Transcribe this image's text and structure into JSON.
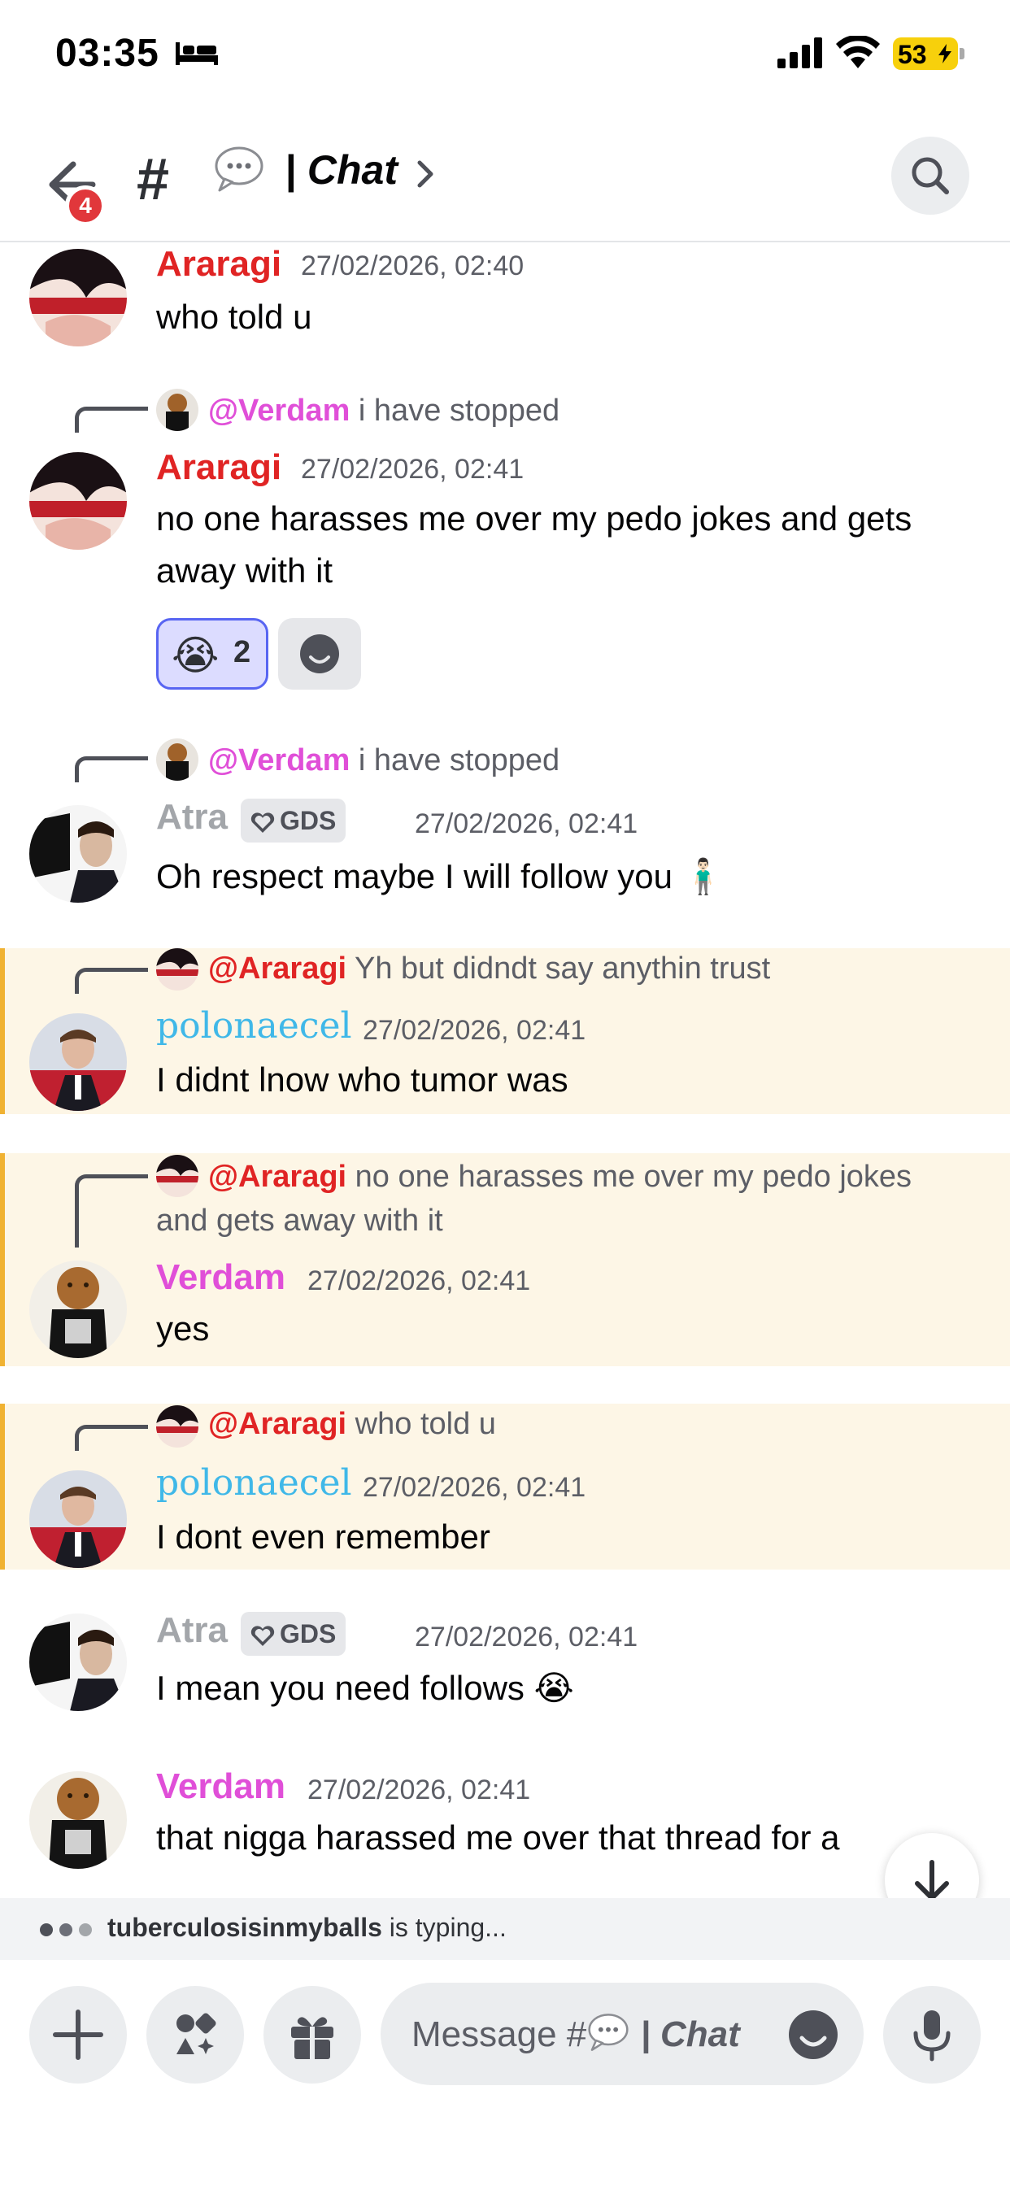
{
  "status_bar": {
    "time": "03:35",
    "battery": "53"
  },
  "header": {
    "title": "| Chat",
    "notification_count": "4",
    "hash": "#"
  },
  "messages": [
    {
      "author": "Araragi",
      "time": "27/02/2026, 02:40",
      "text": "who told u"
    },
    {
      "reply_to": "@Verdam",
      "reply_text": "i have stopped",
      "author": "Araragi",
      "time": "27/02/2026, 02:41",
      "text": "no one harasses me over my pedo jokes and gets away with it",
      "reaction_emoji": "😭",
      "reaction_count": "2"
    },
    {
      "reply_to": "@Verdam",
      "reply_text": "i have stopped",
      "author": "Atra",
      "tag": "GDS",
      "time": "27/02/2026, 02:41",
      "text": "Oh respect maybe I will follow you 🧍🏻‍♂️"
    },
    {
      "reply_to": "@Araragi",
      "reply_text": "Yh but didndt say anythin trust",
      "author": "polonaecel",
      "time": "27/02/2026, 02:41",
      "text": "I didnt lnow who tumor was"
    },
    {
      "reply_to": "@Araragi",
      "reply_text": "no one harasses me over my pedo jokes and gets away with it",
      "author": "Verdam",
      "time": "27/02/2026, 02:41",
      "text": "yes"
    },
    {
      "reply_to": "@Araragi",
      "reply_text": "who told u",
      "author": "polonaecel",
      "time": "27/02/2026, 02:41",
      "text": "I dont even remember"
    },
    {
      "author": "Atra",
      "tag": "GDS",
      "time": "27/02/2026, 02:41",
      "text": "I mean you need follows 😭"
    },
    {
      "author": "Verdam",
      "time": "27/02/2026, 02:41",
      "text": "that nigga harassed me over that thread for a"
    }
  ],
  "typing": {
    "user": "tuberculosisinmyballs",
    "suffix": "is typing..."
  },
  "composer": {
    "placeholder_prefix": "Message #",
    "placeholder_channel": "| Chat"
  },
  "colors": {
    "araragi": "#e02424",
    "verdam": "#e04fd8",
    "atra": "#a3a6aa",
    "polonaecel": "#40b8e8",
    "mention_bg": "#fdf6e6",
    "mention_bar": "#f0b232",
    "blurple": "#5865f2"
  },
  "icons": [
    "bed-icon",
    "signal-icon",
    "wifi-icon",
    "back-arrow-icon",
    "hash-icon",
    "speech-bubble-icon",
    "chevron-right-icon",
    "search-icon",
    "heart-icon",
    "add-reaction-icon",
    "arrow-down-icon",
    "plus-icon",
    "apps-icon",
    "gift-icon",
    "emoji-icon",
    "microphone-icon"
  ]
}
